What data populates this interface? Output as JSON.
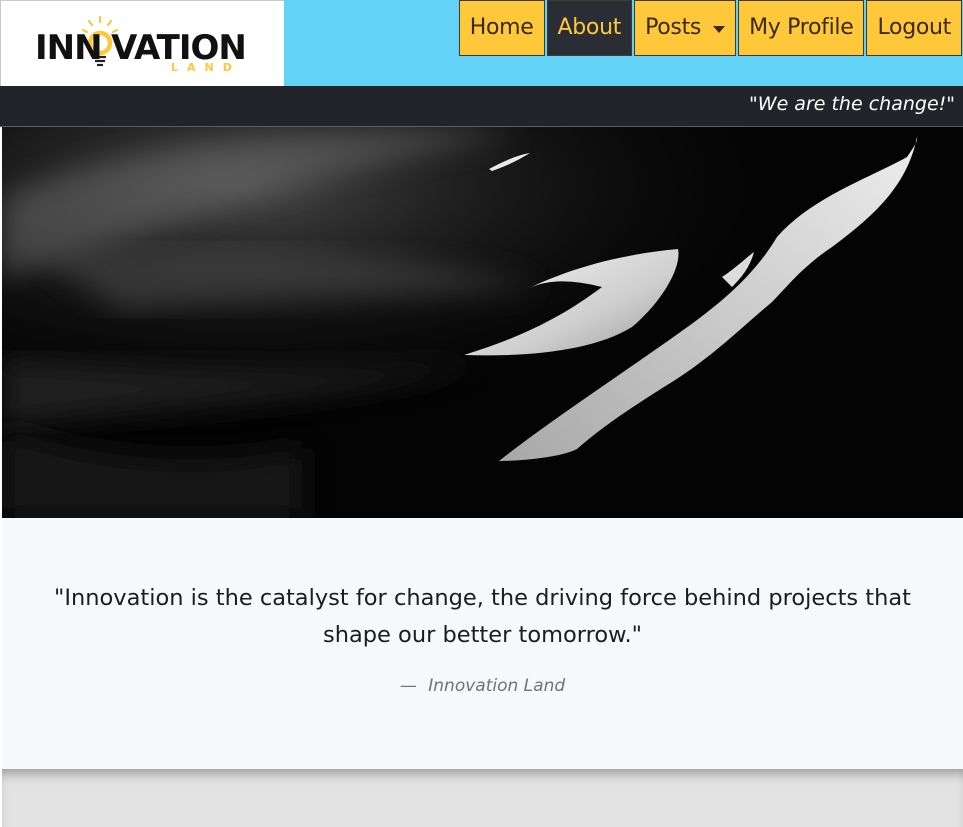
{
  "brand": {
    "logo_main": "INNOVATION",
    "logo_sub": "LAND",
    "accent_color": "#fec83a",
    "dark_color": "#212429",
    "sky_color": "#62d3f7"
  },
  "nav": {
    "items": [
      {
        "label": "Home"
      },
      {
        "label": "About"
      },
      {
        "label": "Posts"
      },
      {
        "label": "My Profile"
      },
      {
        "label": "Logout"
      }
    ]
  },
  "tagline": "\"We are the change!\"",
  "quote": {
    "text": "\"Innovation is the catalyst for change, the driving force behind projects that shape our better tomorrow.\"",
    "dash": "—",
    "author": "Innovation Land"
  }
}
